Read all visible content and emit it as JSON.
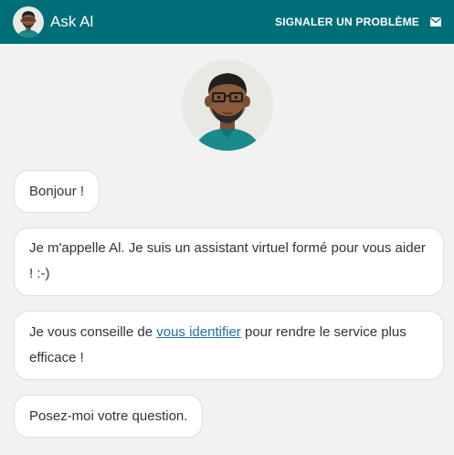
{
  "header": {
    "title": "Ask Al",
    "report_label": "SIGNALER UN PROBLÈME",
    "report_icon": "envelope-icon",
    "background": "#006e78"
  },
  "messages": [
    {
      "text": "Bonjour !"
    },
    {
      "text": "Je m'appelle Al. Je suis un assistant virtuel formé pour vous aider ! :-)"
    },
    {
      "before": "Je vous conseille de ",
      "link": "vous identifier",
      "after": " pour rendre le service plus efficace !"
    },
    {
      "text": "Posez-moi votre question."
    }
  ],
  "colors": {
    "page_background": "#f2f2f2",
    "link": "#1f6fa8",
    "avatar_shirt": "#1a8a8a",
    "avatar_skin": "#8a5a3a"
  }
}
